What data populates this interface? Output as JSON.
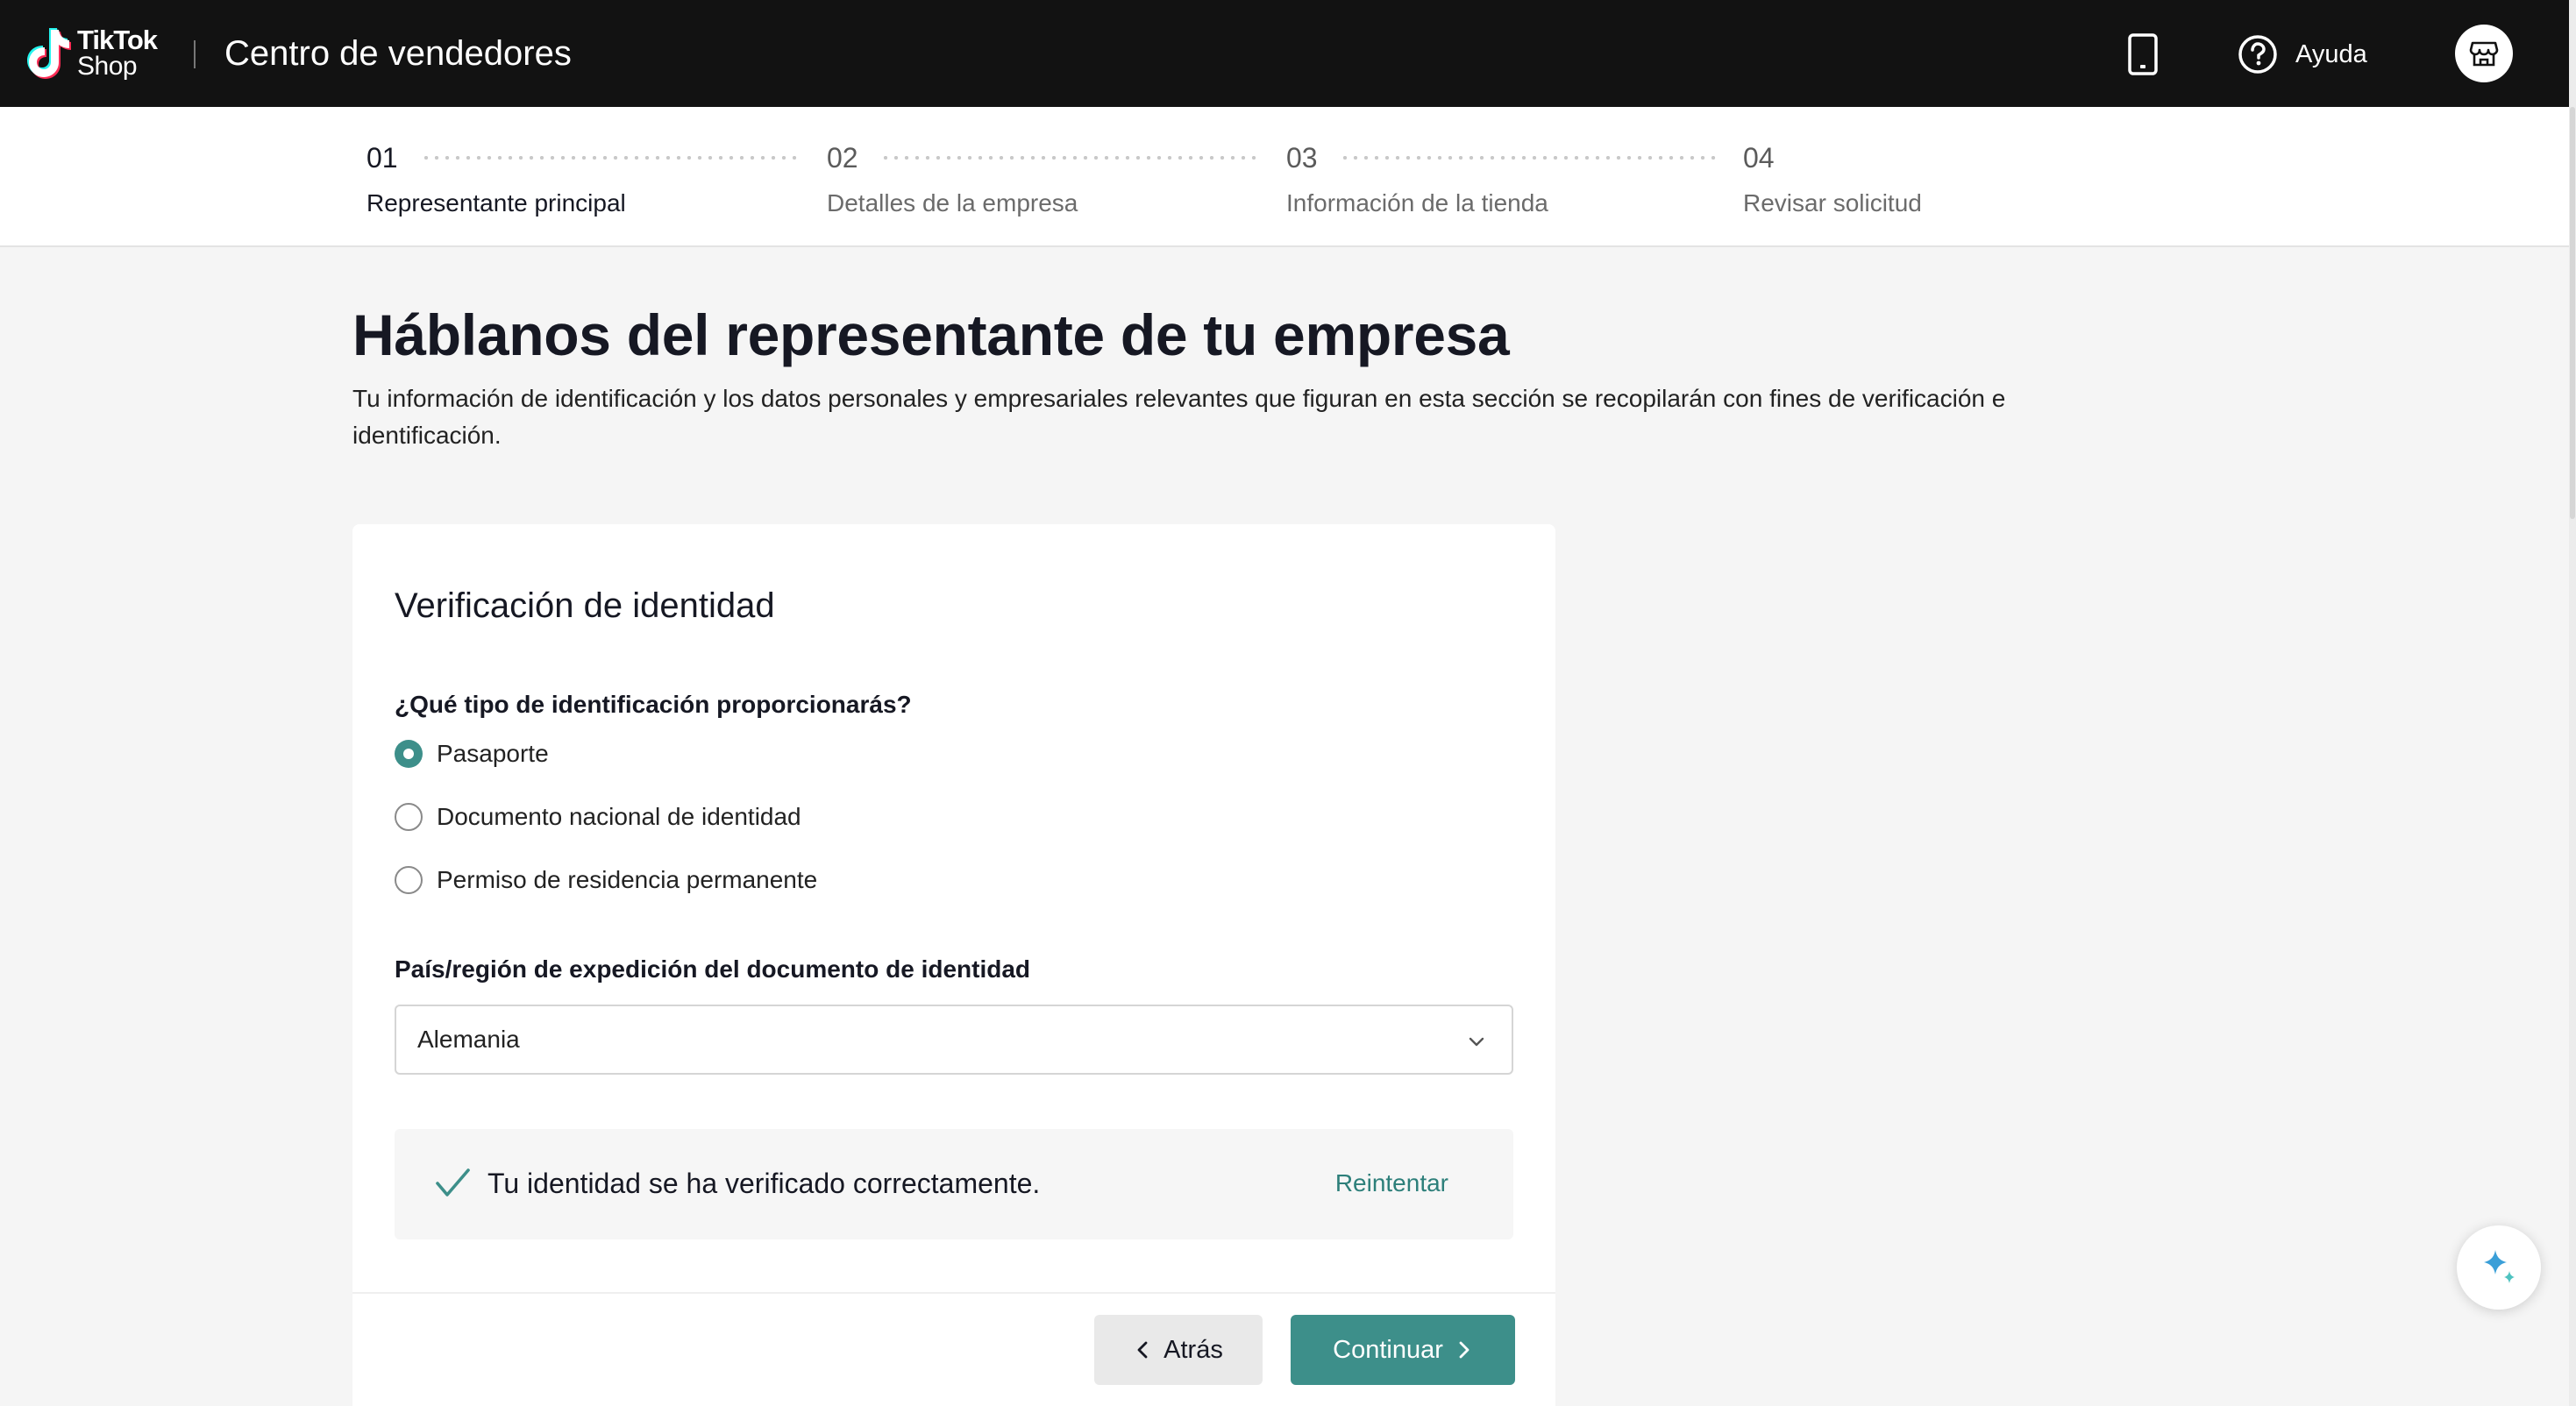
{
  "header": {
    "logo_line1": "TikTok",
    "logo_line2": "Shop",
    "title": "Centro de vendedores",
    "help_label": "Ayuda",
    "icons": {
      "phone": "mobile-phone-icon",
      "help": "question-circle-icon",
      "shop": "store-icon"
    }
  },
  "stepper": {
    "steps": [
      {
        "num": "01",
        "label": "Representante principal",
        "active": true
      },
      {
        "num": "02",
        "label": "Detalles de la empresa",
        "active": false
      },
      {
        "num": "03",
        "label": "Información de la tienda",
        "active": false
      },
      {
        "num": "04",
        "label": "Revisar solicitud",
        "active": false
      }
    ]
  },
  "main": {
    "heading": "Háblanos del representante de tu empresa",
    "subtext": "Tu información de identificación y los datos personales y empresariales relevantes que figuran en esta sección se recopilarán con fines de verificación e identificación."
  },
  "card": {
    "title": "Verificación de identidad",
    "id_question": "¿Qué tipo de identificación proporcionarás?",
    "id_options": [
      {
        "label": "Pasaporte",
        "selected": true
      },
      {
        "label": "Documento nacional de identidad",
        "selected": false
      },
      {
        "label": "Permiso de residencia permanente",
        "selected": false
      }
    ],
    "country_label": "País/región de expedición del documento de identidad",
    "country_value": "Alemania",
    "verified_text": "Tu identidad se ha verificado correctamente.",
    "retry_label": "Reintentar",
    "back_label": "Atrás",
    "continue_label": "Continuar"
  },
  "colors": {
    "accent": "#3d8f8a",
    "link": "#2d7f7a",
    "header_bg": "#121212",
    "page_bg": "#f5f5f5"
  }
}
